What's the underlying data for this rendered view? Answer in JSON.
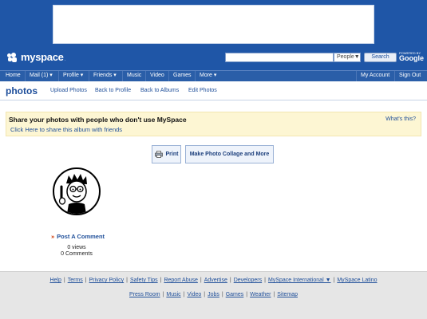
{
  "header": {
    "logo_text": "myspace",
    "logo_tm": ".",
    "search_placeholder": "",
    "search_scope": "People▼",
    "search_button": "Search",
    "powered_by": "POWERED BY",
    "powered_brand": "Google"
  },
  "nav": {
    "items": [
      "Home",
      "Mail (1) ▾",
      "Profile ▾",
      "Friends ▾",
      "Music",
      "Video",
      "Games",
      "More ▾"
    ],
    "right": [
      "My Account",
      "Sign Out"
    ]
  },
  "subnav": {
    "title": "photos",
    "links": [
      "Upload Photos",
      "Back to Profile",
      "Back to Albums",
      "Edit Photos"
    ]
  },
  "share": {
    "title": "Share your photos with people who don't use MySpace",
    "link": "Click Here to share this album with friends",
    "whats_this": "What's this?"
  },
  "actions": {
    "print": "Print",
    "collage": "Make Photo Collage and More"
  },
  "photo": {
    "comment_arrow": "»",
    "comment_label": "Post A Comment",
    "views": "0 views",
    "comments": "0 Comments"
  },
  "footer": {
    "row1": [
      "Help",
      "Terms",
      "Privacy Policy",
      "Safety Tips",
      "Report Abuse",
      "Advertise",
      "Developers",
      "MySpace International ▼",
      "MySpace Latino"
    ],
    "row2": [
      "Press Room",
      "Music",
      "Video",
      "Jobs",
      "Games",
      "Weather",
      "Sitemap"
    ]
  },
  "colors": {
    "brand_blue": "#1f56a7",
    "link_blue": "#1f4f9a",
    "share_bg": "#fdf6d3",
    "footer_bg": "#e6e6e6"
  }
}
